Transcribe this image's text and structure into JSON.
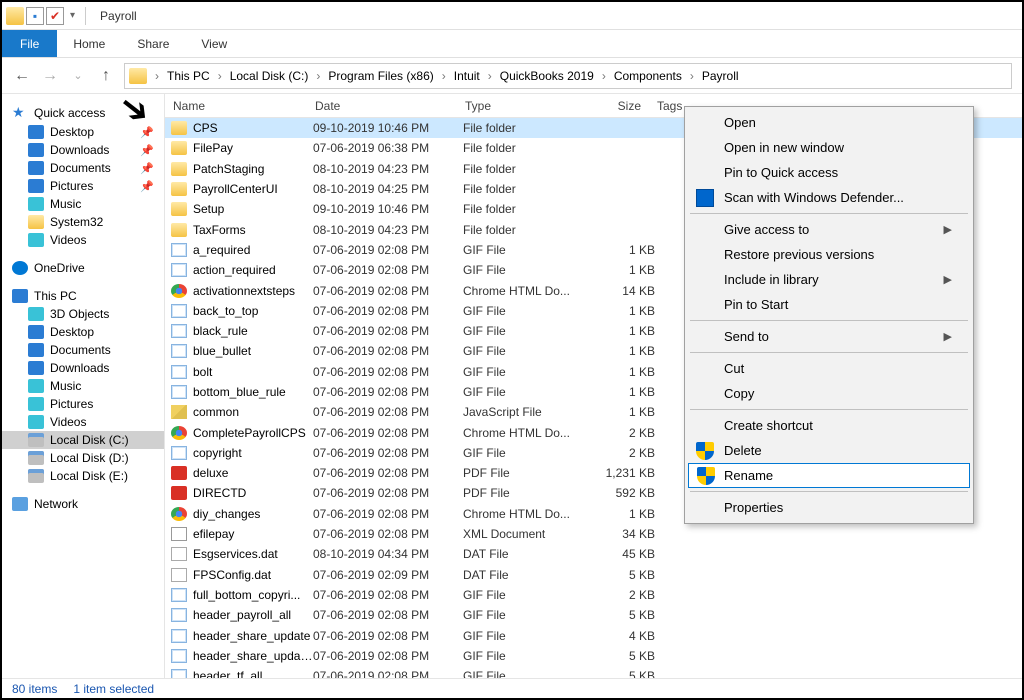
{
  "title": "Payroll",
  "menubar": {
    "file": "File",
    "tabs": [
      "Home",
      "Share",
      "View"
    ]
  },
  "breadcrumb": [
    "This PC",
    "Local Disk (C:)",
    "Program Files (x86)",
    "Intuit",
    "QuickBooks 2019",
    "Components",
    "Payroll"
  ],
  "columns": {
    "name": "Name",
    "date": "Date",
    "type": "Type",
    "size": "Size",
    "tags": "Tags"
  },
  "sidebar": {
    "quick": "Quick access",
    "quick_items": [
      {
        "label": "Desktop",
        "pin": true,
        "ic": "ic-blue"
      },
      {
        "label": "Downloads",
        "pin": true,
        "ic": "ic-blue"
      },
      {
        "label": "Documents",
        "pin": true,
        "ic": "ic-blue"
      },
      {
        "label": "Pictures",
        "pin": true,
        "ic": "ic-blue"
      },
      {
        "label": "Music",
        "pin": false,
        "ic": "ic-cyan"
      },
      {
        "label": "System32",
        "pin": false,
        "ic": "ic-folder"
      },
      {
        "label": "Videos",
        "pin": false,
        "ic": "ic-cyan"
      }
    ],
    "onedrive": "OneDrive",
    "thispc": "This PC",
    "pc_items": [
      {
        "label": "3D Objects",
        "ic": "ic-cyan"
      },
      {
        "label": "Desktop",
        "ic": "ic-blue"
      },
      {
        "label": "Documents",
        "ic": "ic-blue"
      },
      {
        "label": "Downloads",
        "ic": "ic-blue"
      },
      {
        "label": "Music",
        "ic": "ic-cyan"
      },
      {
        "label": "Pictures",
        "ic": "ic-cyan"
      },
      {
        "label": "Videos",
        "ic": "ic-cyan"
      },
      {
        "label": "Local Disk (C:)",
        "ic": "ic-disk",
        "sel": true
      },
      {
        "label": "Local Disk (D:)",
        "ic": "ic-disk"
      },
      {
        "label": "Local Disk (E:)",
        "ic": "ic-disk"
      }
    ],
    "network": "Network"
  },
  "files": [
    {
      "n": "CPS",
      "d": "09-10-2019 10:46 PM",
      "t": "File folder",
      "s": "",
      "ic": "ic-folder",
      "sel": true
    },
    {
      "n": "FilePay",
      "d": "07-06-2019 06:38 PM",
      "t": "File folder",
      "s": "",
      "ic": "ic-folder"
    },
    {
      "n": "PatchStaging",
      "d": "08-10-2019 04:23 PM",
      "t": "File folder",
      "s": "",
      "ic": "ic-folder"
    },
    {
      "n": "PayrollCenterUI",
      "d": "08-10-2019 04:25 PM",
      "t": "File folder",
      "s": "",
      "ic": "ic-folder"
    },
    {
      "n": "Setup",
      "d": "09-10-2019 10:46 PM",
      "t": "File folder",
      "s": "",
      "ic": "ic-folder"
    },
    {
      "n": "TaxForms",
      "d": "08-10-2019 04:23 PM",
      "t": "File folder",
      "s": "",
      "ic": "ic-folder"
    },
    {
      "n": "a_required",
      "d": "07-06-2019 02:08 PM",
      "t": "GIF File",
      "s": "1 KB",
      "ic": "ic-gif"
    },
    {
      "n": "action_required",
      "d": "07-06-2019 02:08 PM",
      "t": "GIF File",
      "s": "1 KB",
      "ic": "ic-gif"
    },
    {
      "n": "activationnextsteps",
      "d": "07-06-2019 02:08 PM",
      "t": "Chrome HTML Do...",
      "s": "14 KB",
      "ic": "ic-chrome"
    },
    {
      "n": "back_to_top",
      "d": "07-06-2019 02:08 PM",
      "t": "GIF File",
      "s": "1 KB",
      "ic": "ic-gif"
    },
    {
      "n": "black_rule",
      "d": "07-06-2019 02:08 PM",
      "t": "GIF File",
      "s": "1 KB",
      "ic": "ic-gif"
    },
    {
      "n": "blue_bullet",
      "d": "07-06-2019 02:08 PM",
      "t": "GIF File",
      "s": "1 KB",
      "ic": "ic-gif"
    },
    {
      "n": "bolt",
      "d": "07-06-2019 02:08 PM",
      "t": "GIF File",
      "s": "1 KB",
      "ic": "ic-gif"
    },
    {
      "n": "bottom_blue_rule",
      "d": "07-06-2019 02:08 PM",
      "t": "GIF File",
      "s": "1 KB",
      "ic": "ic-gif"
    },
    {
      "n": "common",
      "d": "07-06-2019 02:08 PM",
      "t": "JavaScript File",
      "s": "1 KB",
      "ic": "ic-js"
    },
    {
      "n": "CompletePayrollCPS",
      "d": "07-06-2019 02:08 PM",
      "t": "Chrome HTML Do...",
      "s": "2 KB",
      "ic": "ic-chrome"
    },
    {
      "n": "copyright",
      "d": "07-06-2019 02:08 PM",
      "t": "GIF File",
      "s": "2 KB",
      "ic": "ic-gif"
    },
    {
      "n": "deluxe",
      "d": "07-06-2019 02:08 PM",
      "t": "PDF File",
      "s": "1,231 KB",
      "ic": "ic-pdf"
    },
    {
      "n": "DIRECTD",
      "d": "07-06-2019 02:08 PM",
      "t": "PDF File",
      "s": "592 KB",
      "ic": "ic-pdf"
    },
    {
      "n": "diy_changes",
      "d": "07-06-2019 02:08 PM",
      "t": "Chrome HTML Do...",
      "s": "1 KB",
      "ic": "ic-chrome"
    },
    {
      "n": "efilepay",
      "d": "07-06-2019 02:08 PM",
      "t": "XML Document",
      "s": "34 KB",
      "ic": "ic-xml"
    },
    {
      "n": "Esgservices.dat",
      "d": "08-10-2019 04:34 PM",
      "t": "DAT File",
      "s": "45 KB",
      "ic": "ic-dat"
    },
    {
      "n": "FPSConfig.dat",
      "d": "07-06-2019 02:09 PM",
      "t": "DAT File",
      "s": "5 KB",
      "ic": "ic-dat"
    },
    {
      "n": "full_bottom_copyri...",
      "d": "07-06-2019 02:08 PM",
      "t": "GIF File",
      "s": "2 KB",
      "ic": "ic-gif"
    },
    {
      "n": "header_payroll_all",
      "d": "07-06-2019 02:08 PM",
      "t": "GIF File",
      "s": "5 KB",
      "ic": "ic-gif"
    },
    {
      "n": "header_share_update",
      "d": "07-06-2019 02:08 PM",
      "t": "GIF File",
      "s": "4 KB",
      "ic": "ic-gif"
    },
    {
      "n": "header_share_updat...",
      "d": "07-06-2019 02:08 PM",
      "t": "GIF File",
      "s": "5 KB",
      "ic": "ic-gif"
    },
    {
      "n": "header_tf_all",
      "d": "07-06-2019 02:08 PM",
      "t": "GIF File",
      "s": "5 KB",
      "ic": "ic-gif"
    }
  ],
  "context": {
    "open": "Open",
    "open_new": "Open in new window",
    "pin_qa": "Pin to Quick access",
    "defender": "Scan with Windows Defender...",
    "give": "Give access to",
    "restore": "Restore previous versions",
    "include": "Include in library",
    "pin_start": "Pin to Start",
    "send": "Send to",
    "cut": "Cut",
    "copy": "Copy",
    "shortcut": "Create shortcut",
    "delete": "Delete",
    "rename": "Rename",
    "properties": "Properties"
  },
  "status": {
    "count": "80 items",
    "sel": "1 item selected"
  }
}
